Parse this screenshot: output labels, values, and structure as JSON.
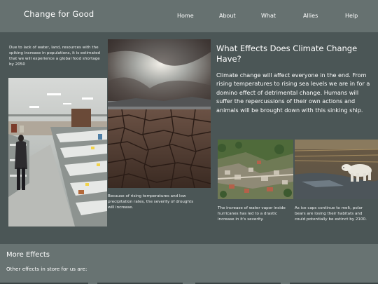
{
  "header": {
    "brand": "Change for Good",
    "nav": [
      "Home",
      "About",
      "What",
      "Allies",
      "Help"
    ]
  },
  "left": {
    "caption_top": "Due to lack of water, land, resources with the spiking increase in populations, it is estimated that we will experience a global food shortage by 2050"
  },
  "center": {
    "caption": "Because of rising temperatures and low precipitation rates, the severity of droughts will increase."
  },
  "right": {
    "heading": "What Effects Does Climate Change Have?",
    "body": "Climate change will affect everyone in the end. From rising temperatures to rising sea levels we are in for a domino effect of detrimental change. Humans will suffer the repercussions of their own actions and animals will be brought down with this sinking ship.",
    "caption_hurricane": "The increase of water vapor inside hurricanes has led to a drastic increase in it's severity.",
    "caption_bear": "As ice caps continue to melt, polar bears are losing their habitats and could potentially be extinct by 2100."
  },
  "more": {
    "title": "More Effects",
    "subtitle": "Other effects in store for us are:"
  },
  "images": {
    "shelves": "empty-shelves-photo",
    "drought": "cracked-earth-photo",
    "hurricane": "hurricane-damage-photo",
    "bear": "polar-bear-photo"
  },
  "colors": {
    "page_bg": "#4b5656",
    "header_bg": "#667170",
    "footer_bg": "#687372",
    "text": "#ffffff"
  }
}
